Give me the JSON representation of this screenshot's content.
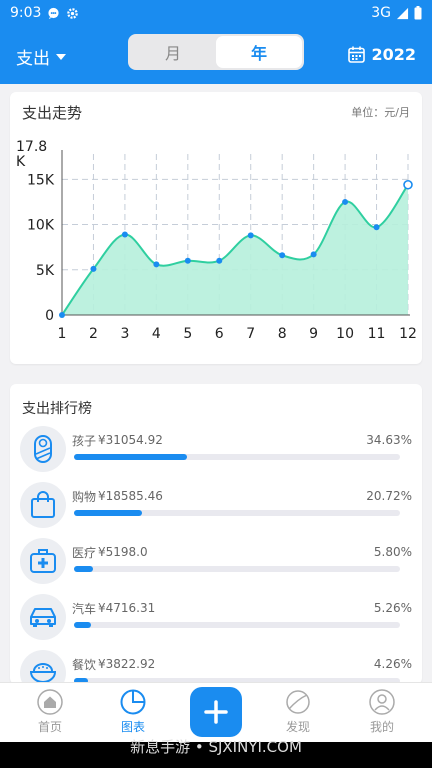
{
  "status": {
    "time": "9:03",
    "network": "3G"
  },
  "header": {
    "type_label": "支出",
    "tabs": [
      {
        "label": "月"
      },
      {
        "label": "年"
      }
    ],
    "year": "2022"
  },
  "trend": {
    "title": "支出走势",
    "unit": "单位：元/月"
  },
  "chart_data": {
    "type": "area",
    "x": [
      1,
      2,
      3,
      4,
      5,
      6,
      7,
      8,
      9,
      10,
      11,
      12
    ],
    "values": [
      0,
      5100,
      8900,
      5600,
      6000,
      6000,
      8800,
      6600,
      6700,
      12500,
      9700,
      14400
    ],
    "ylim": [
      0,
      17800
    ],
    "y_ticks": [
      "0",
      "5K",
      "10K",
      "15K"
    ],
    "y_max_label": "17.8\nK",
    "grid": true,
    "colors": {
      "line": "#2fcfa0",
      "fill": "#b6f0dc",
      "point": "#1a8cf0"
    }
  },
  "ranking": {
    "title": "支出排行榜",
    "items": [
      {
        "name": "孩子",
        "amount": "¥31054.92",
        "percent": "34.63%",
        "ratio": 0.3463,
        "icon": "baby-icon"
      },
      {
        "name": "购物",
        "amount": "¥18585.46",
        "percent": "20.72%",
        "ratio": 0.2072,
        "icon": "shopping-bag-icon"
      },
      {
        "name": "医疗",
        "amount": "¥5198.0",
        "percent": "5.80%",
        "ratio": 0.058,
        "icon": "medical-kit-icon"
      },
      {
        "name": "汽车",
        "amount": "¥4716.31",
        "percent": "5.26%",
        "ratio": 0.0526,
        "icon": "car-icon"
      },
      {
        "name": "餐饮",
        "amount": "¥3822.92",
        "percent": "4.26%",
        "ratio": 0.0426,
        "icon": "food-bowl-icon"
      }
    ]
  },
  "nav": {
    "home": "首页",
    "chart": "图表",
    "discover": "发现",
    "mine": "我的"
  },
  "watermark": "新息手游 • SJXINYI.COM",
  "colors": {
    "accent": "#1a8cf0",
    "background": "#f2f2f4"
  }
}
